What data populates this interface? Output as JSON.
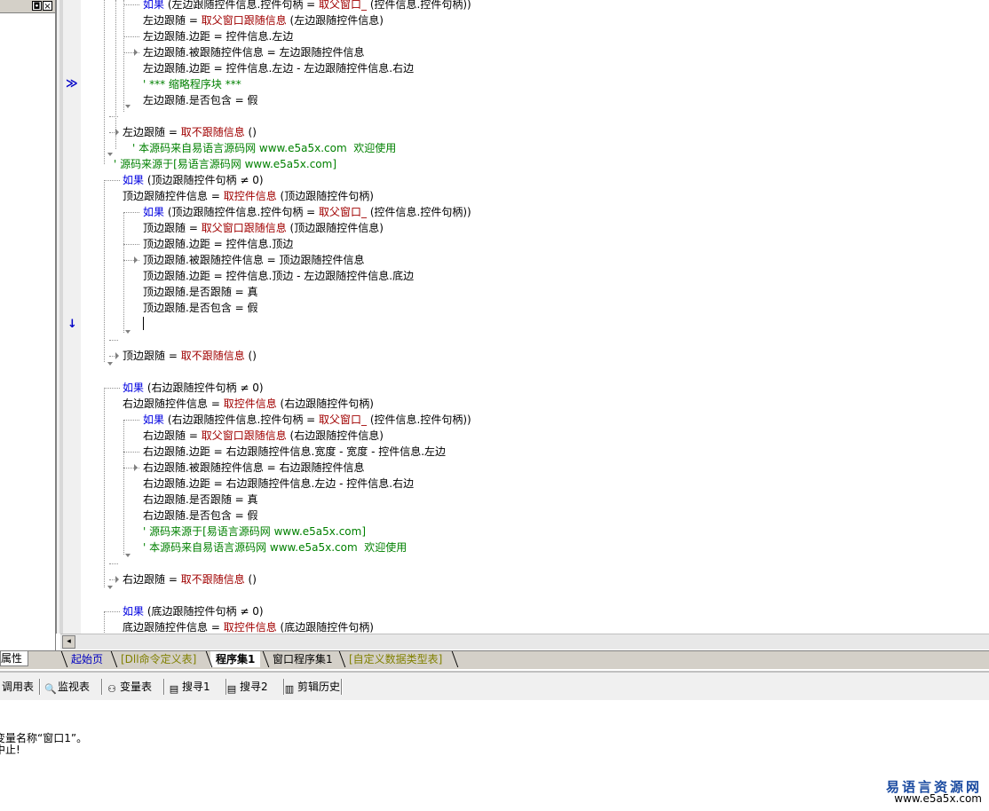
{
  "left_panel": {
    "restore_glyph": "◘",
    "close_glyph": "×",
    "tab_label": "属性"
  },
  "code_lines": [
    {
      "segs": [
        {
          "t": "如果",
          "c": "kw"
        },
        {
          "t": " (左边跟随控件信息.控件句柄 = "
        },
        {
          "t": "取父窗口_",
          "c": "fn"
        },
        {
          "t": " (控件信息.控件句柄))"
        }
      ]
    },
    {
      "segs": [
        {
          "t": "左边跟随 = "
        },
        {
          "t": "取父窗口跟随信息",
          "c": "fn"
        },
        {
          "t": " (左边跟随控件信息)"
        }
      ]
    },
    {
      "segs": [
        {
          "t": "左边跟随.边距 = 控件信息.左边"
        }
      ]
    },
    {
      "segs": [
        {
          "t": "左边跟随.被跟随控件信息 = 左边跟随控件信息"
        }
      ]
    },
    {
      "segs": [
        {
          "t": "左边跟随.边距 = 控件信息.左边 - 左边跟随控件信息.右边"
        }
      ]
    },
    {
      "segs": [
        {
          "t": "' *** 缩略程序块 ***",
          "c": "cm"
        }
      ]
    },
    {
      "segs": [
        {
          "t": "左边跟随.是否包含 = 假"
        }
      ]
    },
    {
      "segs": [
        {
          "t": ""
        }
      ]
    },
    {
      "segs": [
        {
          "t": "左边跟随 = "
        },
        {
          "t": "取不跟随信息",
          "c": "fn"
        },
        {
          "t": " ()"
        }
      ]
    },
    {
      "segs": [
        {
          "t": "' 本源码来自易语言源码网 www.e5a5x.com  欢迎使用",
          "c": "cm"
        }
      ]
    },
    {
      "segs": [
        {
          "t": "' 源码来源于[易语言源码网 www.e5a5x.com]",
          "c": "cm"
        }
      ]
    },
    {
      "segs": [
        {
          "t": "如果",
          "c": "kw"
        },
        {
          "t": " (顶边跟随控件句柄 ≠ 0)"
        }
      ]
    },
    {
      "segs": [
        {
          "t": "顶边跟随控件信息 = "
        },
        {
          "t": "取控件信息",
          "c": "fn"
        },
        {
          "t": " (顶边跟随控件句柄)"
        }
      ]
    },
    {
      "segs": [
        {
          "t": "如果",
          "c": "kw"
        },
        {
          "t": " (顶边跟随控件信息.控件句柄 = "
        },
        {
          "t": "取父窗口_",
          "c": "fn"
        },
        {
          "t": " (控件信息.控件句柄))"
        }
      ]
    },
    {
      "segs": [
        {
          "t": "顶边跟随 = "
        },
        {
          "t": "取父窗口跟随信息",
          "c": "fn"
        },
        {
          "t": " (顶边跟随控件信息)"
        }
      ]
    },
    {
      "segs": [
        {
          "t": "顶边跟随.边距 = 控件信息.顶边"
        }
      ]
    },
    {
      "segs": [
        {
          "t": "顶边跟随.被跟随控件信息 = 顶边跟随控件信息"
        }
      ]
    },
    {
      "segs": [
        {
          "t": "顶边跟随.边距 = 控件信息.顶边 - 左边跟随控件信息.底边"
        }
      ]
    },
    {
      "segs": [
        {
          "t": "顶边跟随.是否跟随 = 真"
        }
      ]
    },
    {
      "segs": [
        {
          "t": "顶边跟随.是否包含 = 假"
        }
      ]
    },
    {
      "segs": [
        {
          "t": ""
        }
      ]
    },
    {
      "segs": [
        {
          "t": ""
        }
      ]
    },
    {
      "segs": [
        {
          "t": "顶边跟随 = "
        },
        {
          "t": "取不跟随信息",
          "c": "fn"
        },
        {
          "t": " ()"
        }
      ]
    },
    {
      "segs": [
        {
          "t": ""
        }
      ]
    },
    {
      "segs": [
        {
          "t": "如果",
          "c": "kw"
        },
        {
          "t": " (右边跟随控件句柄 ≠ 0)"
        }
      ]
    },
    {
      "segs": [
        {
          "t": "右边跟随控件信息 = "
        },
        {
          "t": "取控件信息",
          "c": "fn"
        },
        {
          "t": " (右边跟随控件句柄)"
        }
      ]
    },
    {
      "segs": [
        {
          "t": "如果",
          "c": "kw"
        },
        {
          "t": " (右边跟随控件信息.控件句柄 = "
        },
        {
          "t": "取父窗口_",
          "c": "fn"
        },
        {
          "t": " (控件信息.控件句柄))"
        }
      ]
    },
    {
      "segs": [
        {
          "t": "右边跟随 = "
        },
        {
          "t": "取父窗口跟随信息",
          "c": "fn"
        },
        {
          "t": " (右边跟随控件信息)"
        }
      ]
    },
    {
      "segs": [
        {
          "t": "右边跟随.边距 = 右边跟随控件信息.宽度 - 宽度 - 控件信息.左边"
        }
      ]
    },
    {
      "segs": [
        {
          "t": "右边跟随.被跟随控件信息 = 右边跟随控件信息"
        }
      ]
    },
    {
      "segs": [
        {
          "t": "右边跟随.边距 = 右边跟随控件信息.左边 - 控件信息.右边"
        }
      ]
    },
    {
      "segs": [
        {
          "t": "右边跟随.是否跟随 = 真"
        }
      ]
    },
    {
      "segs": [
        {
          "t": "右边跟随.是否包含 = 假"
        }
      ]
    },
    {
      "segs": [
        {
          "t": "' 源码来源于[易语言源码网 www.e5a5x.com]",
          "c": "cm"
        }
      ]
    },
    {
      "segs": [
        {
          "t": "' 本源码来自易语言源码网 www.e5a5x.com  欢迎使用",
          "c": "cm"
        }
      ]
    },
    {
      "segs": [
        {
          "t": ""
        }
      ]
    },
    {
      "segs": [
        {
          "t": "右边跟随 = "
        },
        {
          "t": "取不跟随信息",
          "c": "fn"
        },
        {
          "t": " ()"
        }
      ]
    },
    {
      "segs": [
        {
          "t": ""
        }
      ]
    },
    {
      "segs": [
        {
          "t": "如果",
          "c": "kw"
        },
        {
          "t": " (底边跟随控件句柄 ≠ 0)"
        }
      ]
    },
    {
      "segs": [
        {
          "t": "底边跟随控件信息 = "
        },
        {
          "t": "取控件信息",
          "c": "fn"
        },
        {
          "t": " (底边跟随控件句柄)"
        }
      ]
    }
  ],
  "gutter": {
    "collapsed_marker": "≫",
    "current_line_marker": "↓"
  },
  "scrollbar": {
    "left_arrow": "◂"
  },
  "doc_tabs": [
    {
      "label": "起始页",
      "color": "#0000c0",
      "bold": false
    },
    {
      "label": "[Dll命令定义表]",
      "color": "#808000",
      "bold": false
    },
    {
      "label": "程序集1",
      "color": "#000000",
      "bold": true
    },
    {
      "label": "窗口程序集1",
      "color": "#000000",
      "bold": false
    },
    {
      "label": "[自定义数据类型表]",
      "color": "#808000",
      "bold": false
    }
  ],
  "bottom_toolbar": [
    {
      "label": "调用表",
      "icon": "call-table-icon",
      "glyph": ""
    },
    {
      "label": "监视表",
      "icon": "magnifier-icon",
      "glyph": "🔍"
    },
    {
      "label": "变量表",
      "icon": "variables-icon",
      "glyph": "⚇"
    },
    {
      "label": "搜寻1",
      "icon": "find1-icon",
      "glyph": "▤"
    },
    {
      "label": "搜寻2",
      "icon": "find2-icon",
      "glyph": "▤"
    },
    {
      "label": "剪辑历史",
      "icon": "clipboard-icon",
      "glyph": "▥"
    }
  ],
  "output_lines": [
    "变量名称“窗口1”。",
    "中止!"
  ],
  "watermark": {
    "title": "易语言资源网",
    "url": "www.e5a5x.com"
  }
}
